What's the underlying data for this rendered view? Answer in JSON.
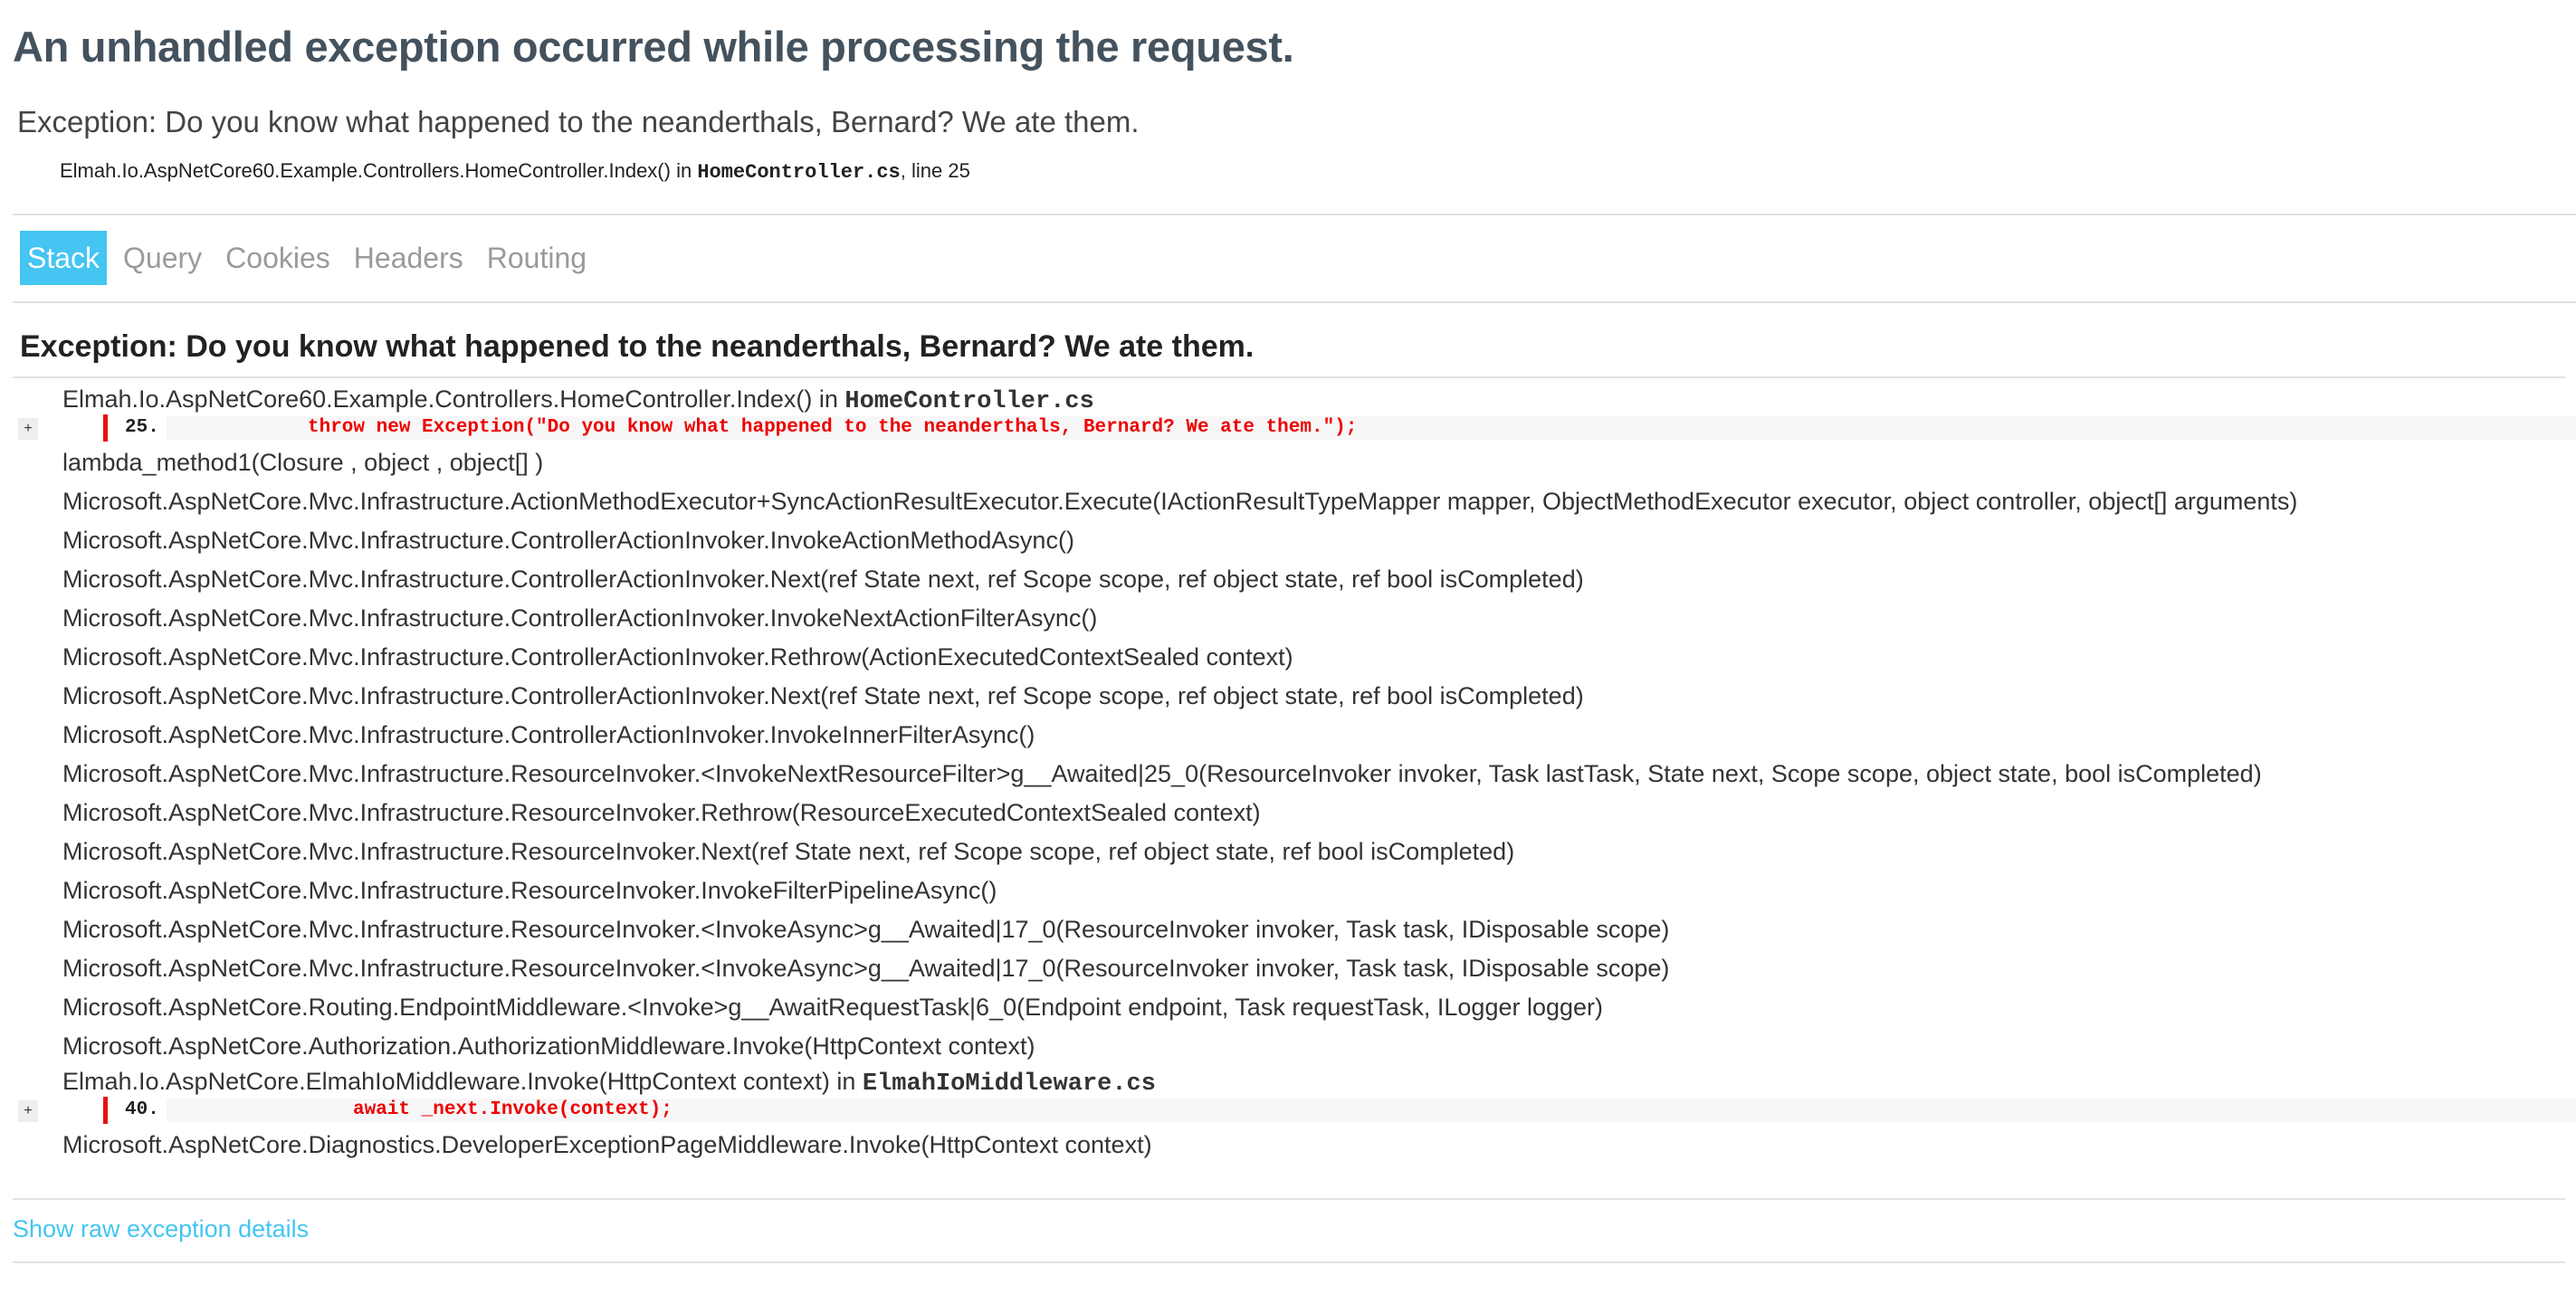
{
  "page": {
    "title": "An unhandled exception occurred while processing the request.",
    "error_summary": "Exception: Do you know what happened to the neanderthals, Bernard? We ate them.",
    "location": {
      "method": "Elmah.Io.AspNetCore60.Example.Controllers.HomeController.Index() in ",
      "file": "HomeController.cs",
      "line_text": ", line 25"
    }
  },
  "tabs": [
    {
      "label": "Stack",
      "active": true
    },
    {
      "label": "Query",
      "active": false
    },
    {
      "label": "Cookies",
      "active": false
    },
    {
      "label": "Headers",
      "active": false
    },
    {
      "label": "Routing",
      "active": false
    }
  ],
  "stack": {
    "heading": "Exception: Do you know what happened to the neanderthals, Bernard? We ate them.",
    "frame0": {
      "method": "Elmah.Io.AspNetCore60.Example.Controllers.HomeController.Index() in ",
      "file": "HomeController.cs",
      "expand_label": "+",
      "line_number": "25.",
      "code": "throw new Exception(\"Do you know what happened to the neanderthals, Bernard? We ate them.\");"
    },
    "frames": [
      "lambda_method1(Closure , object , object[] )",
      "Microsoft.AspNetCore.Mvc.Infrastructure.ActionMethodExecutor+SyncActionResultExecutor.Execute(IActionResultTypeMapper mapper, ObjectMethodExecutor executor, object controller, object[] arguments)",
      "Microsoft.AspNetCore.Mvc.Infrastructure.ControllerActionInvoker.InvokeActionMethodAsync()",
      "Microsoft.AspNetCore.Mvc.Infrastructure.ControllerActionInvoker.Next(ref State next, ref Scope scope, ref object state, ref bool isCompleted)",
      "Microsoft.AspNetCore.Mvc.Infrastructure.ControllerActionInvoker.InvokeNextActionFilterAsync()",
      "Microsoft.AspNetCore.Mvc.Infrastructure.ControllerActionInvoker.Rethrow(ActionExecutedContextSealed context)",
      "Microsoft.AspNetCore.Mvc.Infrastructure.ControllerActionInvoker.Next(ref State next, ref Scope scope, ref object state, ref bool isCompleted)",
      "Microsoft.AspNetCore.Mvc.Infrastructure.ControllerActionInvoker.InvokeInnerFilterAsync()",
      "Microsoft.AspNetCore.Mvc.Infrastructure.ResourceInvoker.<InvokeNextResourceFilter>g__Awaited|25_0(ResourceInvoker invoker, Task lastTask, State next, Scope scope, object state, bool isCompleted)",
      "Microsoft.AspNetCore.Mvc.Infrastructure.ResourceInvoker.Rethrow(ResourceExecutedContextSealed context)",
      "Microsoft.AspNetCore.Mvc.Infrastructure.ResourceInvoker.Next(ref State next, ref Scope scope, ref object state, ref bool isCompleted)",
      "Microsoft.AspNetCore.Mvc.Infrastructure.ResourceInvoker.InvokeFilterPipelineAsync()",
      "Microsoft.AspNetCore.Mvc.Infrastructure.ResourceInvoker.<InvokeAsync>g__Awaited|17_0(ResourceInvoker invoker, Task task, IDisposable scope)",
      "Microsoft.AspNetCore.Mvc.Infrastructure.ResourceInvoker.<InvokeAsync>g__Awaited|17_0(ResourceInvoker invoker, Task task, IDisposable scope)",
      "Microsoft.AspNetCore.Routing.EndpointMiddleware.<Invoke>g__AwaitRequestTask|6_0(Endpoint endpoint, Task requestTask, ILogger logger)",
      "Microsoft.AspNetCore.Authorization.AuthorizationMiddleware.Invoke(HttpContext context)"
    ],
    "frame_elmah": {
      "method": "Elmah.Io.AspNetCore.ElmahIoMiddleware.Invoke(HttpContext context) in ",
      "file": "ElmahIoMiddleware.cs",
      "expand_label": "+",
      "line_number": "40.",
      "code": "await _next.Invoke(context);"
    },
    "frame_last": "Microsoft.AspNetCore.Diagnostics.DeveloperExceptionPageMiddleware.Invoke(HttpContext context)"
  },
  "raw_link": "Show raw exception details",
  "colors": {
    "accent": "#44c5f2",
    "title": "#44525e",
    "code_error": "#ee0000",
    "marker": "#e81010"
  }
}
